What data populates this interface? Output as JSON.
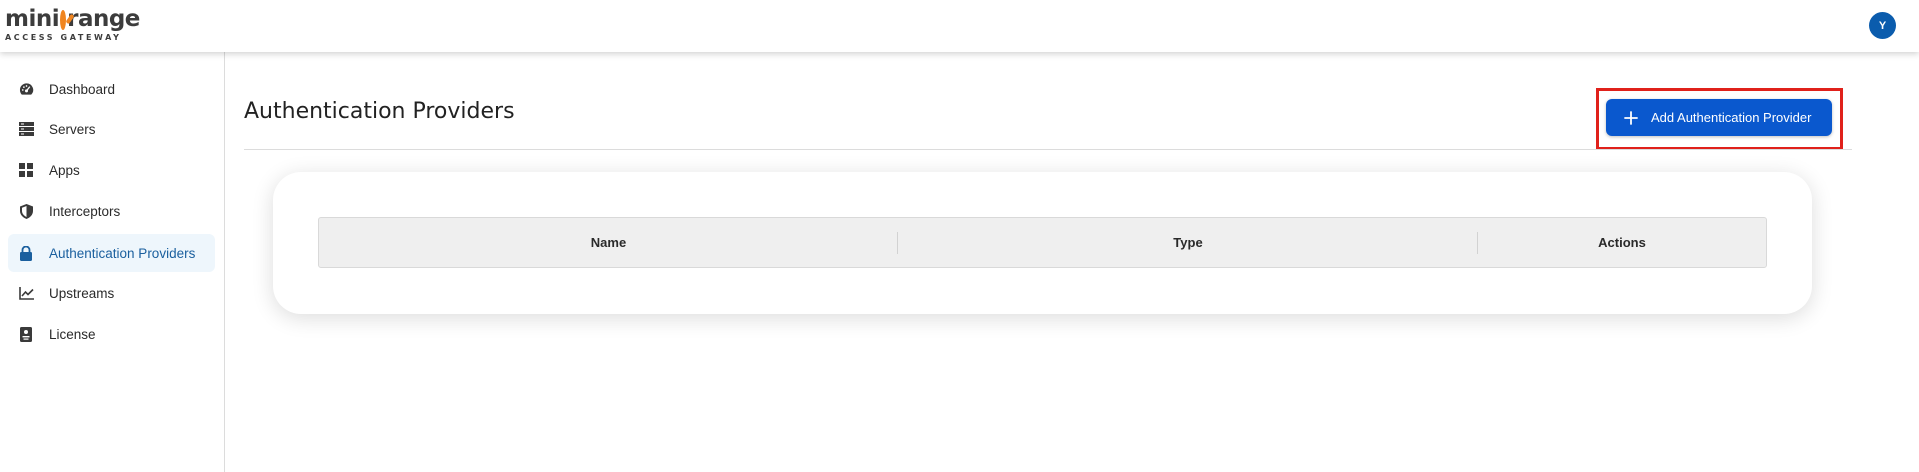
{
  "header": {
    "logo_main_left": "mini",
    "logo_main_right": "range",
    "logo_sub": "ACCESS GATEWAY",
    "avatar_initial": "Y"
  },
  "sidebar": {
    "items": [
      {
        "label": "Dashboard",
        "icon": "dashboard-gauge-icon"
      },
      {
        "label": "Servers",
        "icon": "server-stack-icon"
      },
      {
        "label": "Apps",
        "icon": "apps-grid-icon"
      },
      {
        "label": "Interceptors",
        "icon": "shield-icon"
      },
      {
        "label": "Authentication Providers",
        "icon": "lock-icon",
        "active": true
      },
      {
        "label": "Upstreams",
        "icon": "line-chart-icon"
      },
      {
        "label": "License",
        "icon": "license-badge-icon"
      }
    ]
  },
  "main": {
    "title": "Authentication Providers",
    "add_button_label": "Add Authentication Provider",
    "table": {
      "columns": [
        "Name",
        "Type",
        "Actions"
      ],
      "rows": []
    }
  },
  "colors": {
    "primary_button": "#0a58ce",
    "active_nav_bg": "#eef6fc",
    "active_nav_text": "#1a5f9e",
    "highlight_border": "#e0211b",
    "logo_orange": "#f0851f",
    "avatar_bg": "#0b5cad"
  }
}
